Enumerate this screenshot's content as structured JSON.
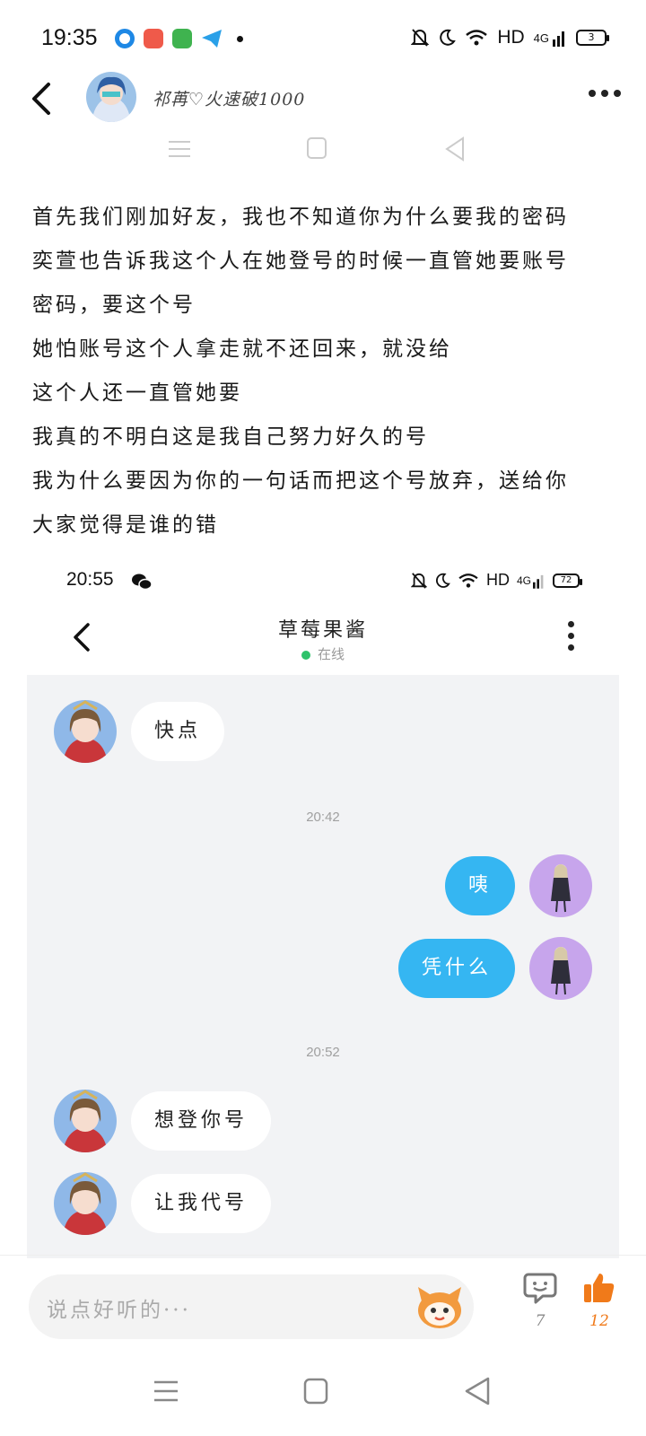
{
  "status_bar": {
    "time": "19:35",
    "network": "HD",
    "signal": "4G",
    "battery": "3",
    "app_icons": [
      "browser-icon",
      "music-icon",
      "store-icon",
      "telegram-icon"
    ]
  },
  "header": {
    "author_name": "祁苒♡火速破1000",
    "back_icon": "chevron-left-icon",
    "more_icon": "more-horizontal-icon"
  },
  "post": {
    "lines": [
      "首先我们刚加好友，我也不知道你为什么要我的密码",
      "奕萱也告诉我这个人在她登号的时候一直管她要账号",
      "密码，要这个号",
      "她怕账号这个人拿走就不还回来，就没给",
      "这个人还一直管她要",
      "我真的不明白这是我自己努力好久的号",
      "我为什么要因为你的一句话而把这个号放弃，送给你",
      "大家觉得是谁的错"
    ]
  },
  "screenshot": {
    "status": {
      "time": "20:55",
      "network": "HD",
      "signal": "4G",
      "battery": "72"
    },
    "chat_title": "草莓果酱",
    "online_status": "在线",
    "messages": [
      {
        "side": "in",
        "text": "快点"
      },
      {
        "timestamp": "20:42"
      },
      {
        "side": "out",
        "text": "咦"
      },
      {
        "side": "out",
        "text": "凭什么"
      },
      {
        "timestamp": "20:52"
      },
      {
        "side": "in",
        "text": "想登你号"
      },
      {
        "side": "in",
        "text": "让我代号"
      }
    ]
  },
  "bottom_bar": {
    "comment_placeholder": "说点好听的···",
    "comment_count": "7",
    "like_count": "12"
  },
  "colors": {
    "accent_blue": "#35b6f2",
    "like_orange": "#f07a1a",
    "online_green": "#2ec26a",
    "chat_bg": "#f2f3f5"
  }
}
